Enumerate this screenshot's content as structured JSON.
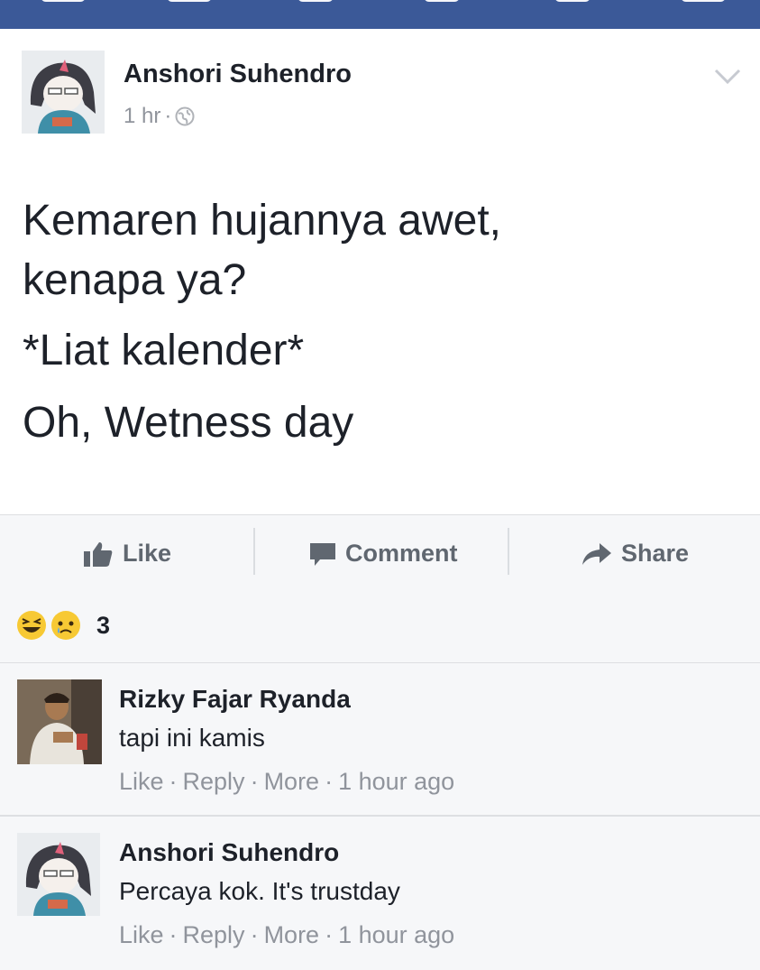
{
  "colors": {
    "brand_blue": "#3b5998",
    "meta_gray": "#90949c",
    "action_gray": "#606770"
  },
  "post": {
    "author": "Anshori Suhendro",
    "time": "1 hr",
    "meta_separator": "·",
    "privacy_icon": "globe-icon",
    "body": [
      "Kemaren hujannya awet,",
      "kenapa ya?",
      "*Liat kalender*",
      "Oh, Wetness day"
    ]
  },
  "actions": {
    "like": "Like",
    "comment": "Comment",
    "share": "Share"
  },
  "reactions": {
    "icons": [
      "laughing-emoji",
      "sad-emoji"
    ],
    "count": "3"
  },
  "comments": [
    {
      "author": "Rizky Fajar Ryanda",
      "text": "tapi ini kamis",
      "like": "Like",
      "reply": "Reply",
      "more": "More",
      "time": "1 hour ago",
      "sep": "·"
    },
    {
      "author": "Anshori Suhendro",
      "text": "Percaya kok. It's trustday",
      "like": "Like",
      "reply": "Reply",
      "more": "More",
      "time": "1 hour ago",
      "sep": "·"
    }
  ]
}
